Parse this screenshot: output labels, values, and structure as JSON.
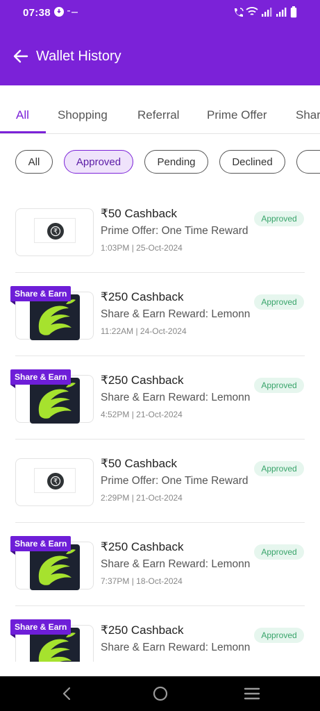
{
  "status_bar": {
    "time": "07:38",
    "icons": [
      "notification-icon",
      "wifi-calling-icon",
      "wifi-icon",
      "signal-icon",
      "signal-icon",
      "battery-icon"
    ]
  },
  "header": {
    "title": "Wallet History",
    "back_icon": "arrow-left-icon",
    "background": "#7B22D8"
  },
  "tabs": [
    {
      "label": "All",
      "active": true
    },
    {
      "label": "Shopping",
      "active": false
    },
    {
      "label": "Referral",
      "active": false
    },
    {
      "label": "Prime Offer",
      "active": false
    },
    {
      "label": "Shar",
      "active": false
    }
  ],
  "filters": [
    {
      "label": "All",
      "active": false
    },
    {
      "label": "Approved",
      "active": true
    },
    {
      "label": "Pending",
      "active": false
    },
    {
      "label": "Declined",
      "active": false
    }
  ],
  "transactions": [
    {
      "type": "prime",
      "tag": "",
      "title": "₹50 Cashback",
      "subtitle": "Prime Offer: One Time Reward",
      "time": "1:03PM | 25-Oct-2024",
      "status": "Approved"
    },
    {
      "type": "share",
      "tag": "Share & Earn",
      "title": "₹250 Cashback",
      "subtitle": "Share & Earn Reward: Lemonn",
      "time": "11:22AM | 24-Oct-2024",
      "status": "Approved"
    },
    {
      "type": "share",
      "tag": "Share & Earn",
      "title": "₹250 Cashback",
      "subtitle": "Share & Earn Reward: Lemonn",
      "time": "4:52PM | 21-Oct-2024",
      "status": "Approved"
    },
    {
      "type": "prime",
      "tag": "",
      "title": "₹50 Cashback",
      "subtitle": "Prime Offer: One Time Reward",
      "time": "2:29PM | 21-Oct-2024",
      "status": "Approved"
    },
    {
      "type": "share",
      "tag": "Share & Earn",
      "title": "₹250 Cashback",
      "subtitle": "Share & Earn Reward: Lemonn",
      "time": "7:37PM | 18-Oct-2024",
      "status": "Approved"
    },
    {
      "type": "share",
      "tag": "Share & Earn",
      "title": "₹250 Cashback",
      "subtitle": "Share & Earn Reward: Lemonn",
      "time": "",
      "status": "Approved"
    }
  ],
  "colors": {
    "accent": "#7B22D8",
    "approved_bg": "#E6F6EE",
    "approved_text": "#38a46a",
    "logo_green": "#A6E22E"
  },
  "nav_bar": {
    "icons": [
      "back-nav-icon",
      "home-nav-icon",
      "recents-nav-icon"
    ]
  }
}
